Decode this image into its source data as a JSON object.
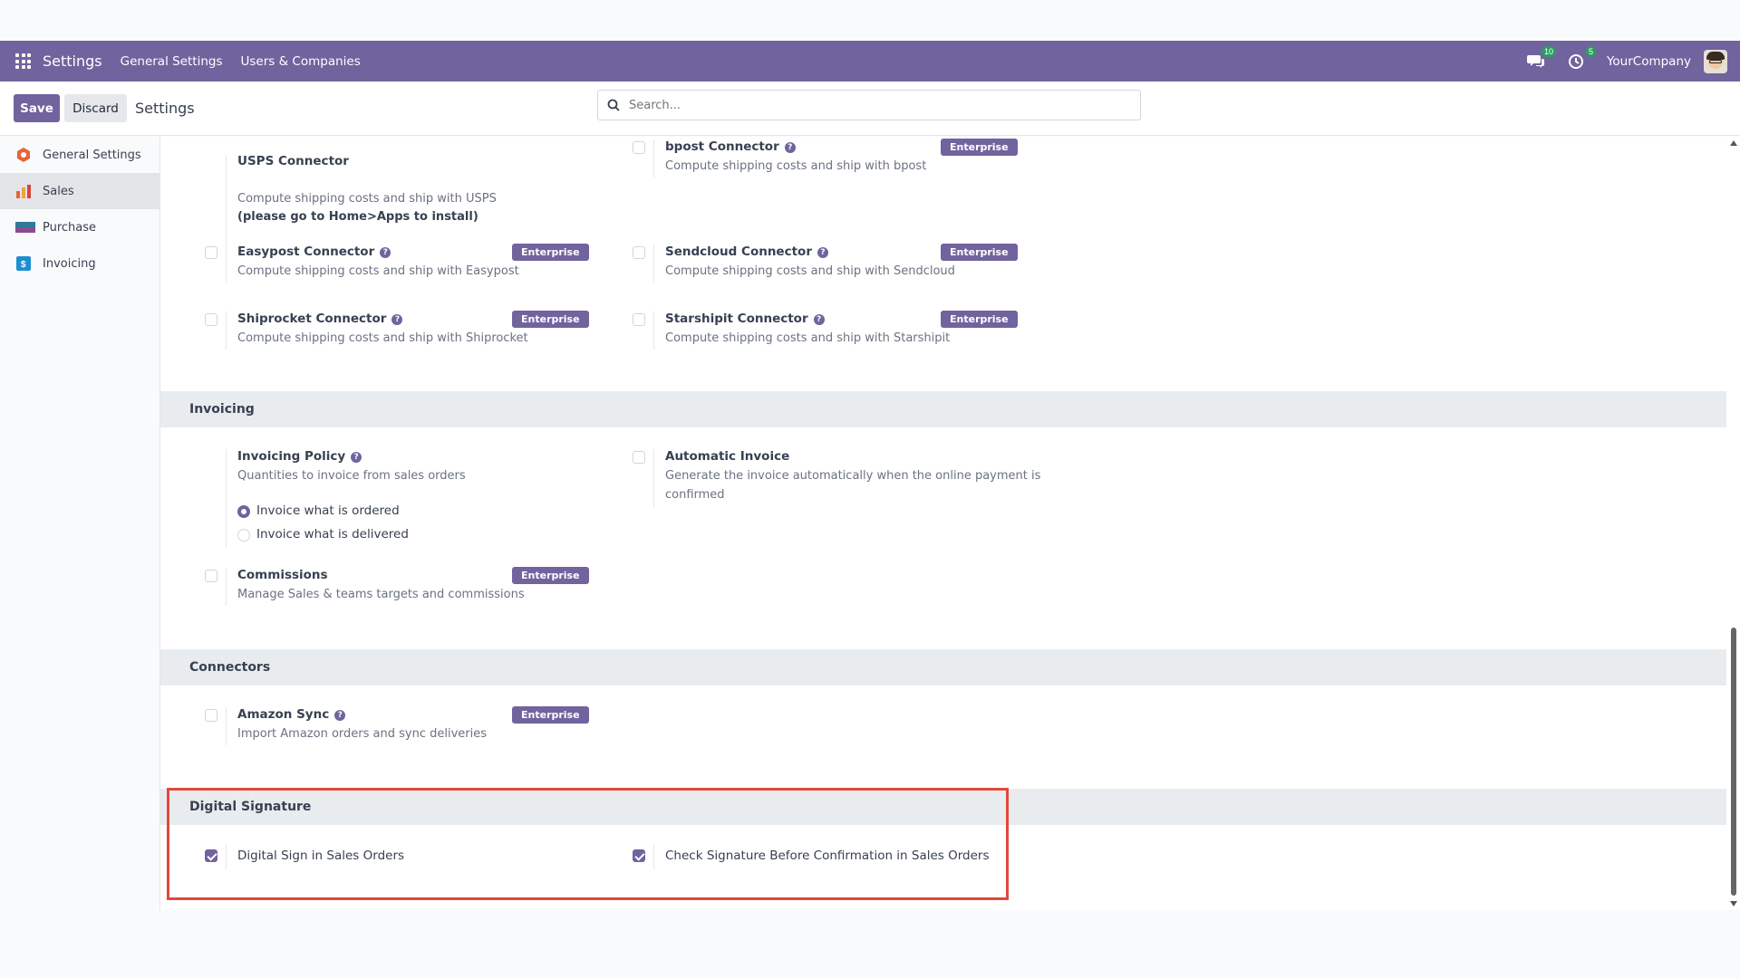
{
  "navbar": {
    "app_name": "Settings",
    "menu": [
      "General Settings",
      "Users & Companies"
    ],
    "messages_count": "10",
    "activities_count": "5",
    "company": "YourCompany"
  },
  "control_bar": {
    "save_label": "Save",
    "discard_label": "Discard",
    "title": "Settings",
    "search_placeholder": "Search..."
  },
  "sidebar": {
    "items": [
      {
        "label": "General Settings",
        "icon": "settings-gear-icon"
      },
      {
        "label": "Sales",
        "icon": "sales-chart-icon"
      },
      {
        "label": "Purchase",
        "icon": "purchase-icon"
      },
      {
        "label": "Invoicing",
        "icon": "invoicing-icon"
      }
    ],
    "active": "Sales"
  },
  "shipping": {
    "usps": {
      "title": "USPS Connector",
      "desc": "Compute shipping costs and ship with USPS",
      "note": "(please go to Home>Apps to install)"
    },
    "bpost": {
      "title": "bpost Connector",
      "desc": "Compute shipping costs and ship with bpost",
      "badge": "Enterprise"
    },
    "easypost": {
      "title": "Easypost Connector",
      "desc": "Compute shipping costs and ship with Easypost",
      "badge": "Enterprise"
    },
    "sendcloud": {
      "title": "Sendcloud Connector",
      "desc": "Compute shipping costs and ship with Sendcloud",
      "badge": "Enterprise"
    },
    "shiprocket": {
      "title": "Shiprocket Connector",
      "desc": "Compute shipping costs and ship with Shiprocket",
      "badge": "Enterprise"
    },
    "starshipit": {
      "title": "Starshipit Connector",
      "desc": "Compute shipping costs and ship with Starshipit",
      "badge": "Enterprise"
    }
  },
  "invoicing": {
    "heading": "Invoicing",
    "policy": {
      "title": "Invoicing Policy",
      "desc": "Quantities to invoice from sales orders",
      "options": [
        "Invoice what is ordered",
        "Invoice what is delivered"
      ],
      "selected": "Invoice what is ordered"
    },
    "automatic": {
      "title": "Automatic Invoice",
      "desc_line1": "Generate the invoice automatically when the online payment is",
      "desc_line2": "confirmed"
    },
    "commissions": {
      "title": "Commissions",
      "desc": "Manage Sales & teams targets and commissions",
      "badge": "Enterprise"
    }
  },
  "connectors": {
    "heading": "Connectors",
    "amazon": {
      "title": "Amazon Sync",
      "desc": "Import Amazon orders and sync deliveries",
      "badge": "Enterprise"
    }
  },
  "digital_signature": {
    "heading": "Digital Signature",
    "sign_in_orders": {
      "label": "Digital Sign in Sales Orders",
      "checked": true
    },
    "check_before_confirm": {
      "label": "Check Signature Before Confirmation in Sales Orders",
      "checked": true
    }
  },
  "colors": {
    "brand": "#71639e",
    "highlight": "#e2483d",
    "badge_green": "#2a9d62"
  }
}
